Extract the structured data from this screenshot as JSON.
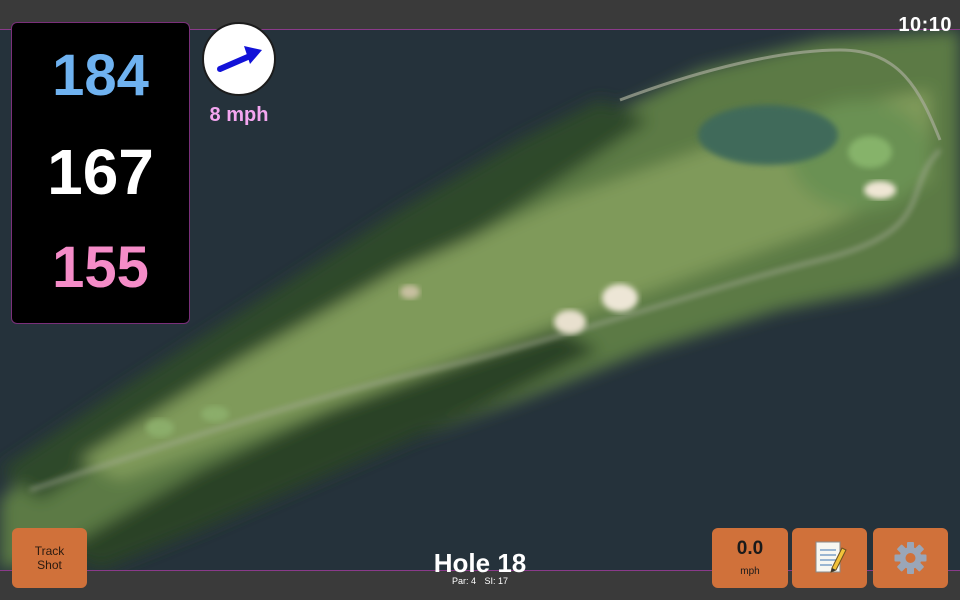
{
  "status": {
    "time": "10:10"
  },
  "distances": {
    "back": "184",
    "middle": "167",
    "front": "155"
  },
  "wind": {
    "speed": "8 mph",
    "arrow_icon": "wind-arrow-icon"
  },
  "track_shot": {
    "line1": "Track",
    "line2": "Shot"
  },
  "hole": {
    "title": "Hole 18",
    "par": "Par: 4",
    "stroke_index": "SI: 17"
  },
  "shot_speed": {
    "value": "0.0",
    "unit": "mph"
  },
  "icons": {
    "notes": "notepad-icon",
    "settings": "gear-icon"
  },
  "colors": {
    "back_distance": "#6fb2f0",
    "middle_distance": "#ffffff",
    "front_distance": "#f58cc8",
    "wind_text": "#f4a6f0",
    "button": "#d0713a",
    "wind_arrow": "#1212d8"
  }
}
